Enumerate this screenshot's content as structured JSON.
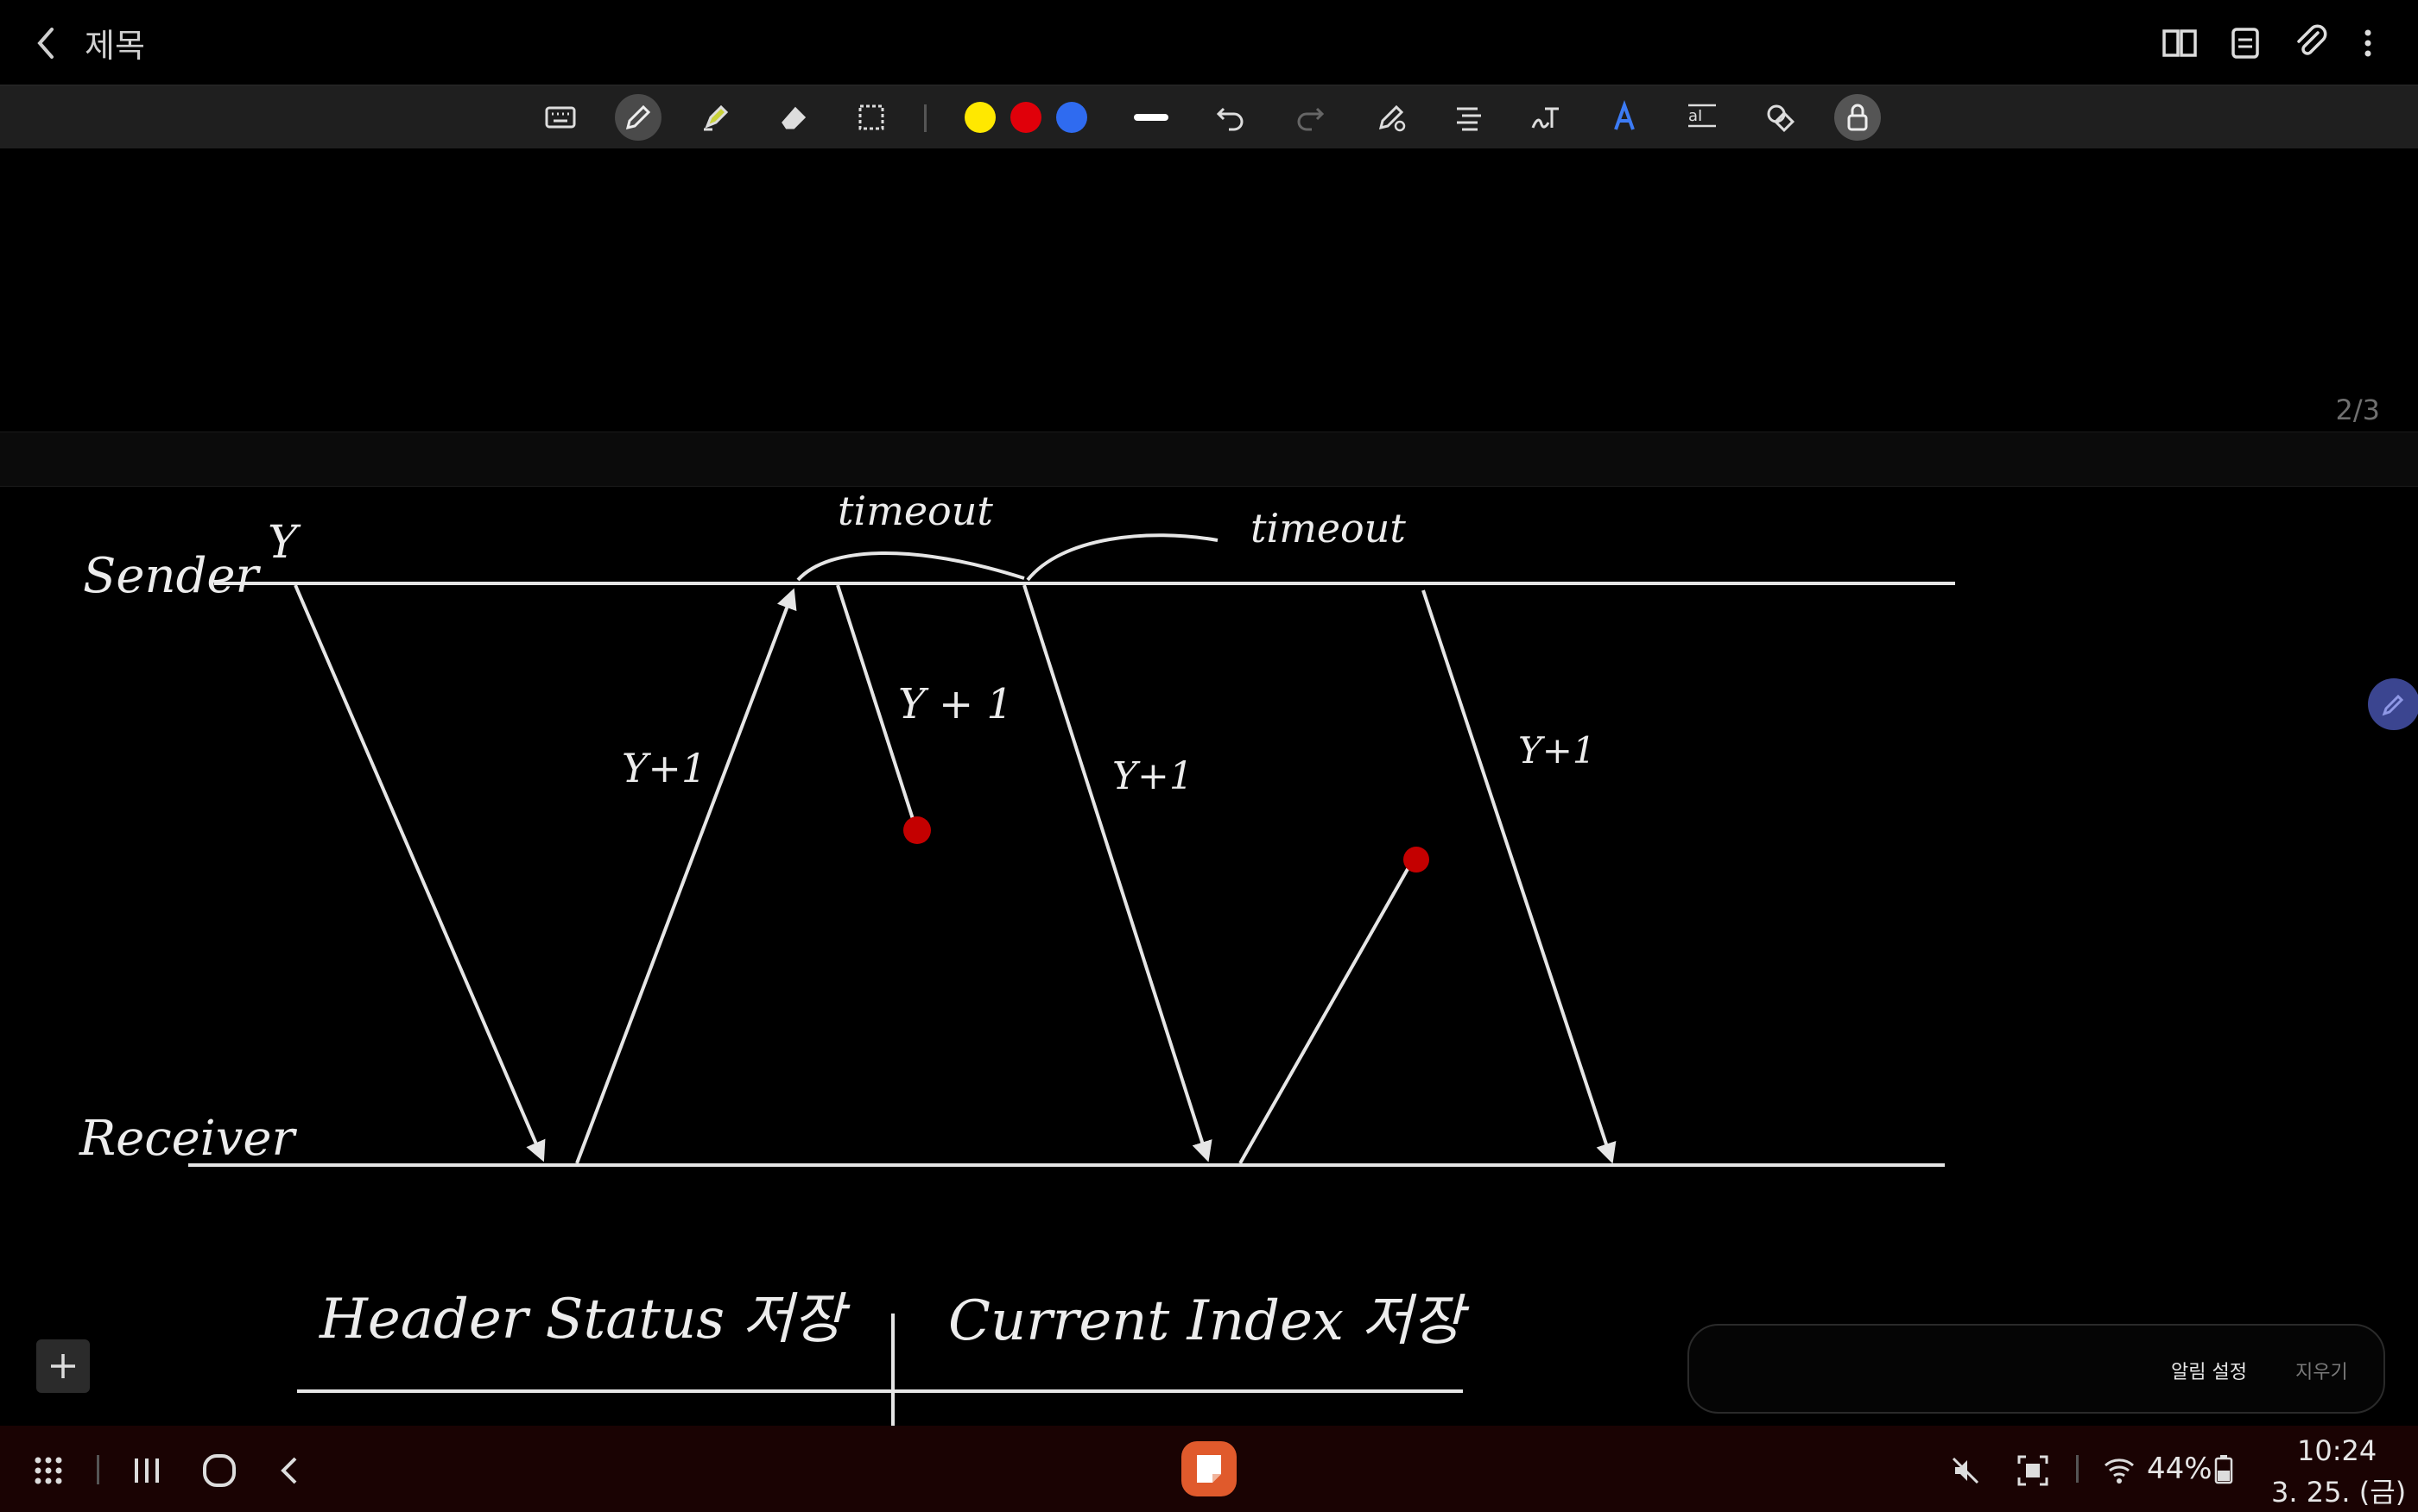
{
  "header": {
    "title": "제목",
    "icons": [
      "back-icon",
      "book-icon",
      "page-list-icon",
      "attach-icon",
      "more-icon"
    ]
  },
  "toolbar": {
    "tools": [
      "keyboard-icon",
      "pen-icon",
      "highlighter-icon",
      "eraser-icon",
      "selection-icon",
      "undo-icon",
      "redo-icon",
      "pen-settings-icon",
      "text-style-icon",
      "handwriting-icon",
      "text-color-icon",
      "text-convert-icon",
      "shapes-icon",
      "lock-icon"
    ],
    "colors": [
      "#FFE800",
      "#E0000A",
      "#2F6BF0"
    ],
    "selected_tool": "pen-icon"
  },
  "canvas": {
    "page_indicator": "2/3",
    "handwriting": {
      "sender": "Sender",
      "receiver": "Receiver",
      "y": "Y",
      "yplus1_a": "Y+1",
      "yplus1_b": "Y + 1",
      "yplus1_c": "Y+1",
      "yplus1_d": "Y+1",
      "timeout_1": "timeout",
      "timeout_2": "timeout",
      "header_status": "Header Status 저장",
      "current_index": "Current Index 저장"
    }
  },
  "notification": {
    "settings": "알림 설정",
    "clear": "지우기"
  },
  "navbar": {
    "battery": "44%",
    "time": "10:24",
    "date": "3. 25. (금)"
  }
}
